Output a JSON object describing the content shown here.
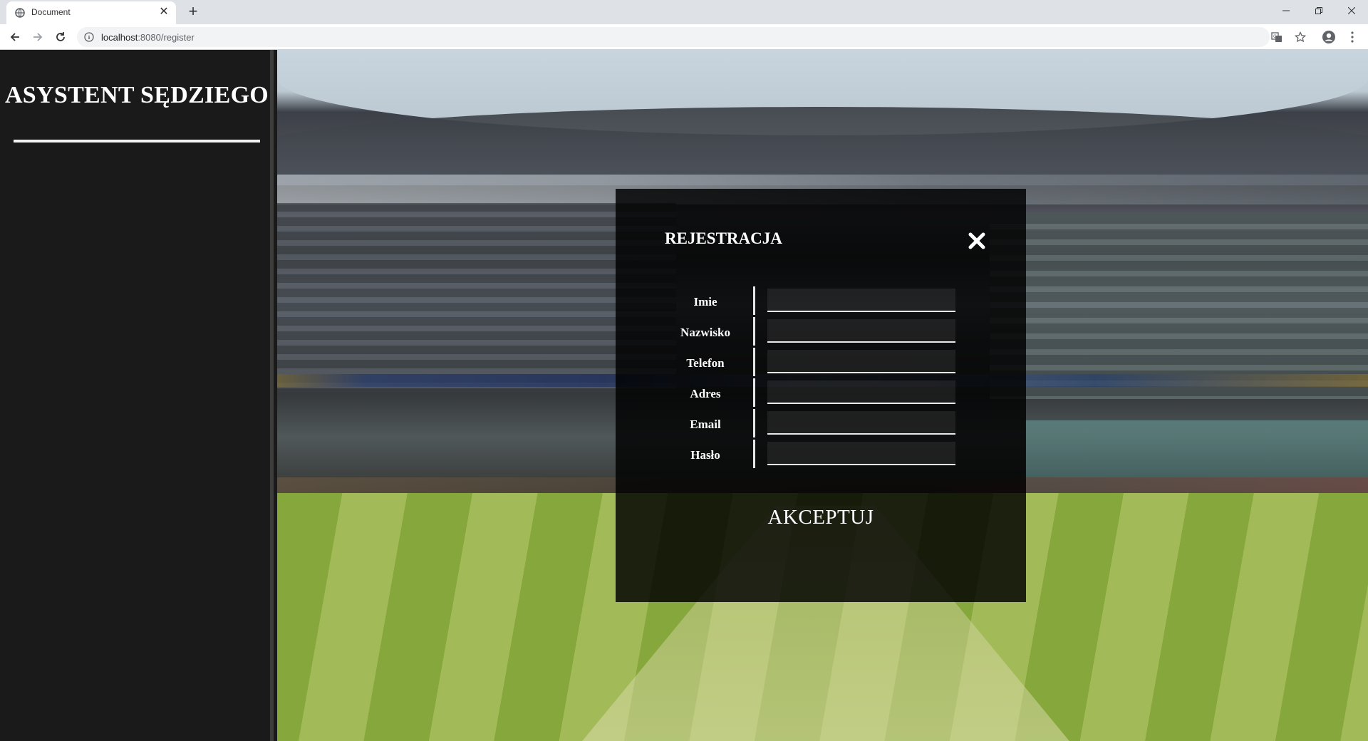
{
  "browser": {
    "tab_title": "Document",
    "url_host": "localhost",
    "url_path": ":8080/register"
  },
  "sidebar": {
    "brand": "ASYSTENT SĘDZIEGO"
  },
  "modal": {
    "title": "REJESTRACJA",
    "fields": [
      {
        "label": "Imie",
        "value": ""
      },
      {
        "label": "Nazwisko",
        "value": ""
      },
      {
        "label": "Telefon",
        "value": ""
      },
      {
        "label": "Adres",
        "value": ""
      },
      {
        "label": "Email",
        "value": ""
      },
      {
        "label": "Hasło",
        "value": ""
      }
    ],
    "submit_label": "AKCEPTUJ"
  },
  "colors": {
    "sidebar_bg": "#1a1a1a",
    "modal_bg": "rgba(0,0,0,0.83)",
    "text": "#ffffff"
  },
  "icons": {
    "favicon": "globe-icon",
    "close_tab": "close-icon",
    "new_tab": "plus-icon",
    "modal_close": "close-icon"
  }
}
